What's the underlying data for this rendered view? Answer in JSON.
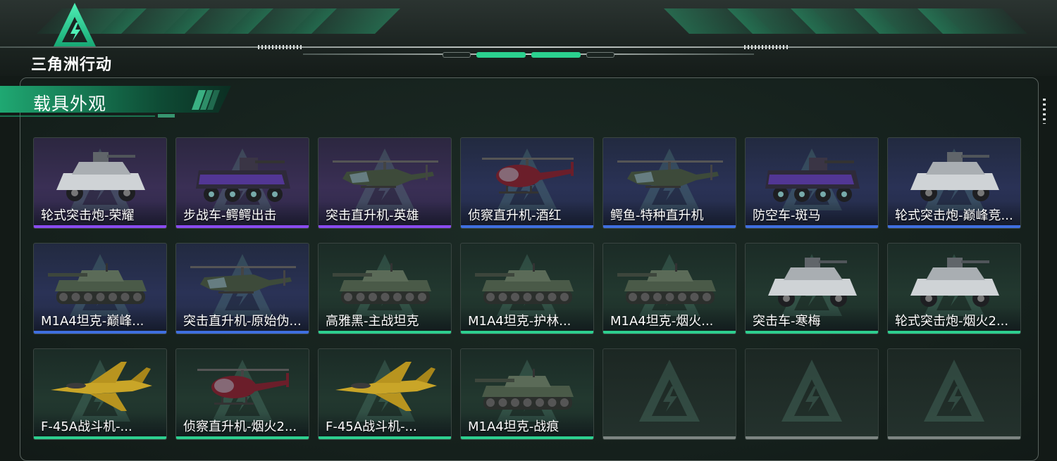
{
  "app": {
    "logo_text": "三角洲行动"
  },
  "section": {
    "title": "载具外观"
  },
  "colors": {
    "accent": "#2bd18f",
    "rarity_purple": "#8a4bf0",
    "rarity_blue": "#3f6fe0",
    "rarity_green": "#2dcf8f",
    "empty": "#7d8582"
  },
  "vehicles": [
    {
      "name": "轮式突击炮-荣耀",
      "rarity": "purple",
      "icon": "armored-car-icon"
    },
    {
      "name": "步战车-鳄鳄出击",
      "rarity": "purple",
      "icon": "ifv-icon"
    },
    {
      "name": "突击直升机-英雄",
      "rarity": "purple",
      "icon": "attack-helicopter-icon"
    },
    {
      "name": "侦察直升机-酒红",
      "rarity": "blue",
      "icon": "scout-helicopter-icon"
    },
    {
      "name": "鳄鱼-特种直升机",
      "rarity": "blue",
      "icon": "attack-helicopter-icon"
    },
    {
      "name": "防空车-斑马",
      "rarity": "blue",
      "icon": "ifv-icon"
    },
    {
      "name": "轮式突击炮-巅峰竞...",
      "rarity": "blue",
      "icon": "armored-car-icon"
    },
    {
      "name": "M1A4坦克-巅峰...",
      "rarity": "blue",
      "icon": "tank-icon"
    },
    {
      "name": "突击直升机-原始伪...",
      "rarity": "blue",
      "icon": "attack-helicopter-icon"
    },
    {
      "name": "高雅黑-主战坦克",
      "rarity": "green",
      "icon": "tank-icon"
    },
    {
      "name": "M1A4坦克-护林...",
      "rarity": "green",
      "icon": "tank-icon"
    },
    {
      "name": "M1A4坦克-烟火...",
      "rarity": "green",
      "icon": "tank-icon"
    },
    {
      "name": "突击车-寒梅",
      "rarity": "green",
      "icon": "armored-car-icon"
    },
    {
      "name": "轮式突击炮-烟火2...",
      "rarity": "green",
      "icon": "armored-car-icon"
    },
    {
      "name": "F-45A战斗机-...",
      "rarity": "green",
      "icon": "fighter-jet-icon"
    },
    {
      "name": "侦察直升机-烟火2...",
      "rarity": "green",
      "icon": "scout-helicopter-icon"
    },
    {
      "name": "F-45A战斗机-...",
      "rarity": "green",
      "icon": "fighter-jet-icon"
    },
    {
      "name": "M1A4坦克-战痕",
      "rarity": "green",
      "icon": "tank-icon"
    },
    {
      "name": "",
      "rarity": "empty",
      "icon": "delta-logo-icon"
    },
    {
      "name": "",
      "rarity": "empty",
      "icon": "delta-logo-icon"
    },
    {
      "name": "",
      "rarity": "empty",
      "icon": "delta-logo-icon"
    }
  ]
}
